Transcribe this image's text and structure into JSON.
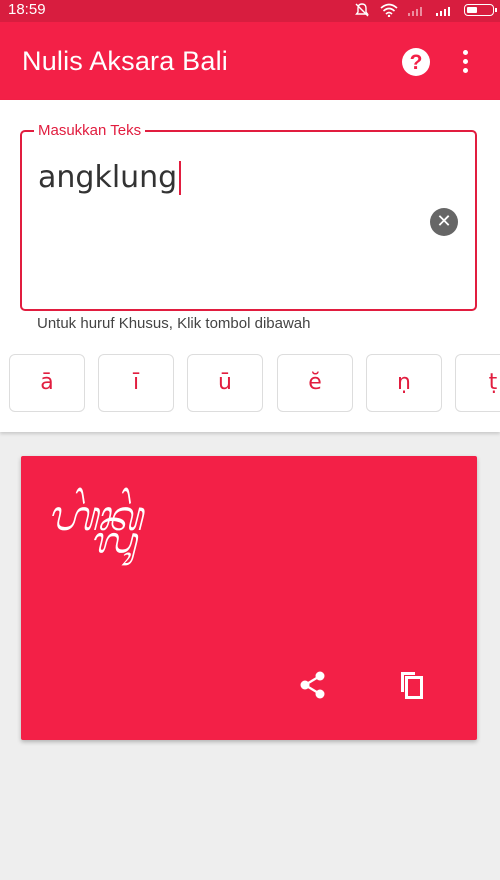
{
  "status_bar": {
    "time": "18:59"
  },
  "app_bar": {
    "title": "Nulis Aksara Bali",
    "help_label": "?"
  },
  "input": {
    "label": "Masukkan Teks",
    "value": "angklung",
    "clear_label": "✕"
  },
  "hint": "Untuk huruf Khusus, Klik tombol dibawah",
  "special_keys": [
    "ā",
    "ī",
    "ū",
    "ĕ",
    "ṇ",
    "ṭ"
  ],
  "output": {
    "script_text": "ᬳᬂᬓ᭄ᬮᬸᬂ"
  },
  "colors": {
    "primary": "#f32047",
    "status_bar": "#d81d3f",
    "accent": "#e11d3f",
    "background": "#eeeeee"
  },
  "icons": [
    "do-not-disturb-icon",
    "wifi-icon",
    "signal-icon",
    "battery-icon",
    "help-icon",
    "more-vert-icon",
    "clear-icon",
    "share-icon",
    "copy-icon"
  ]
}
